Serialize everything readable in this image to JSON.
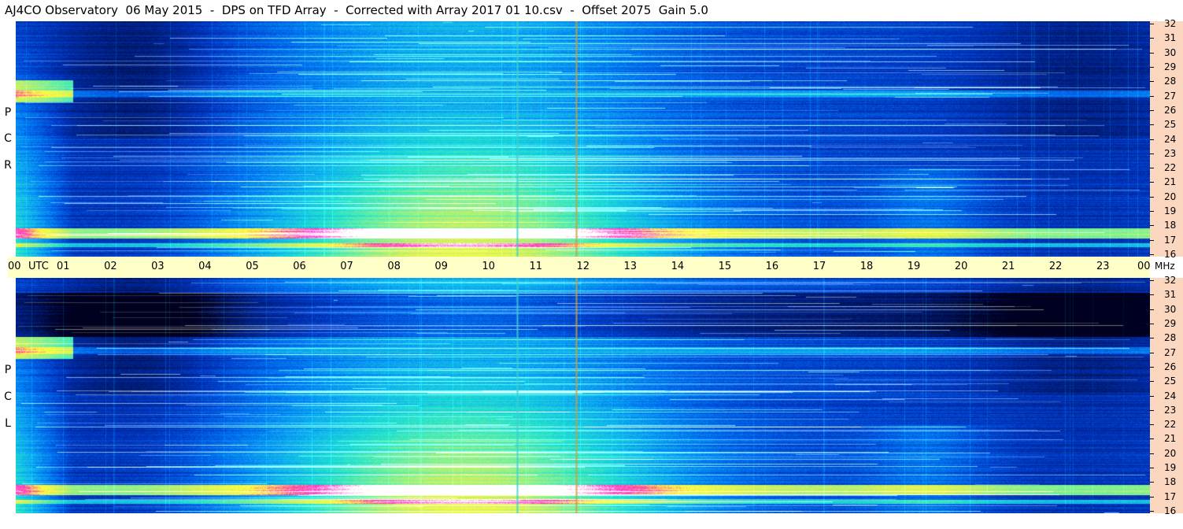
{
  "header": {
    "title": "AJ4CO Observatory  06 May 2015  -  DPS on TFD Array  -  Corrected with Array 2017 01 10.csv  -  Offset 2075  Gain 5.0"
  },
  "chart_data": {
    "type": "heatmap",
    "title": "AJ4CO Observatory  06 May 2015  -  DPS on TFD Array  -  Corrected with Array 2017 01 10.csv  -  Offset 2075  Gain 5.0",
    "x_axis": {
      "unit_label": "UTC",
      "range": [
        0,
        24
      ],
      "tick_labels": [
        "00",
        "01",
        "02",
        "03",
        "04",
        "05",
        "06",
        "07",
        "08",
        "09",
        "10",
        "11",
        "12",
        "13",
        "14",
        "15",
        "16",
        "17",
        "18",
        "19",
        "20",
        "21",
        "22",
        "23",
        "00"
      ]
    },
    "y_axis": {
      "unit_label": "MHz",
      "range": [
        16,
        32
      ],
      "tick_labels": [
        "16",
        "17",
        "18",
        "19",
        "20",
        "21",
        "22",
        "23",
        "24",
        "25",
        "26",
        "27",
        "28",
        "29",
        "30",
        "31",
        "32"
      ]
    },
    "panels": [
      {
        "name": "RCP",
        "letters": [
          "R",
          "C",
          "P"
        ]
      },
      {
        "name": "LCP",
        "letters": [
          "L",
          "C",
          "P"
        ]
      }
    ],
    "colormap": [
      "#000020",
      "#001a70",
      "#0035c0",
      "#0070f0",
      "#10b0f0",
      "#20e0d0",
      "#70f0a0",
      "#d0f060",
      "#ffff40",
      "#ff30c0",
      "#ffffff"
    ],
    "notable_features": [
      {
        "type": "vertical_line",
        "x_hour": 11.85,
        "color": "#c8a040"
      },
      {
        "type": "vertical_line",
        "x_hour": 10.6,
        "color": "#40d0d0"
      },
      {
        "type": "horizontal_band",
        "freq_mhz": 17.5,
        "note": "strong interference band"
      },
      {
        "type": "horizontal_band",
        "freq_mhz": 27.0,
        "note": "interference band"
      }
    ]
  }
}
